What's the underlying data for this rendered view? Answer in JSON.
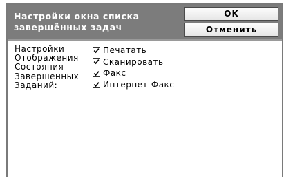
{
  "dialog": {
    "title_lines": [
      "Настройки окна списка",
      "завершённых задач"
    ]
  },
  "buttons": {
    "ok": "OK",
    "cancel": "Отменить"
  },
  "settings": {
    "label_lines": [
      "Настройки",
      "Отображения",
      "Состояния",
      "Завершенных",
      "Заданий:"
    ],
    "options": [
      {
        "label": "Печатать",
        "checked": true
      },
      {
        "label": "Сканировать",
        "checked": true
      },
      {
        "label": "Факс",
        "checked": true
      },
      {
        "label": "Интернет-Факс",
        "checked": true
      }
    ]
  },
  "colors": {
    "header_bg": "#7c7c7c",
    "header_text": "#ffffff",
    "panel_bg": "#ffffff"
  },
  "icons": {
    "checkbox": "check-icon"
  }
}
